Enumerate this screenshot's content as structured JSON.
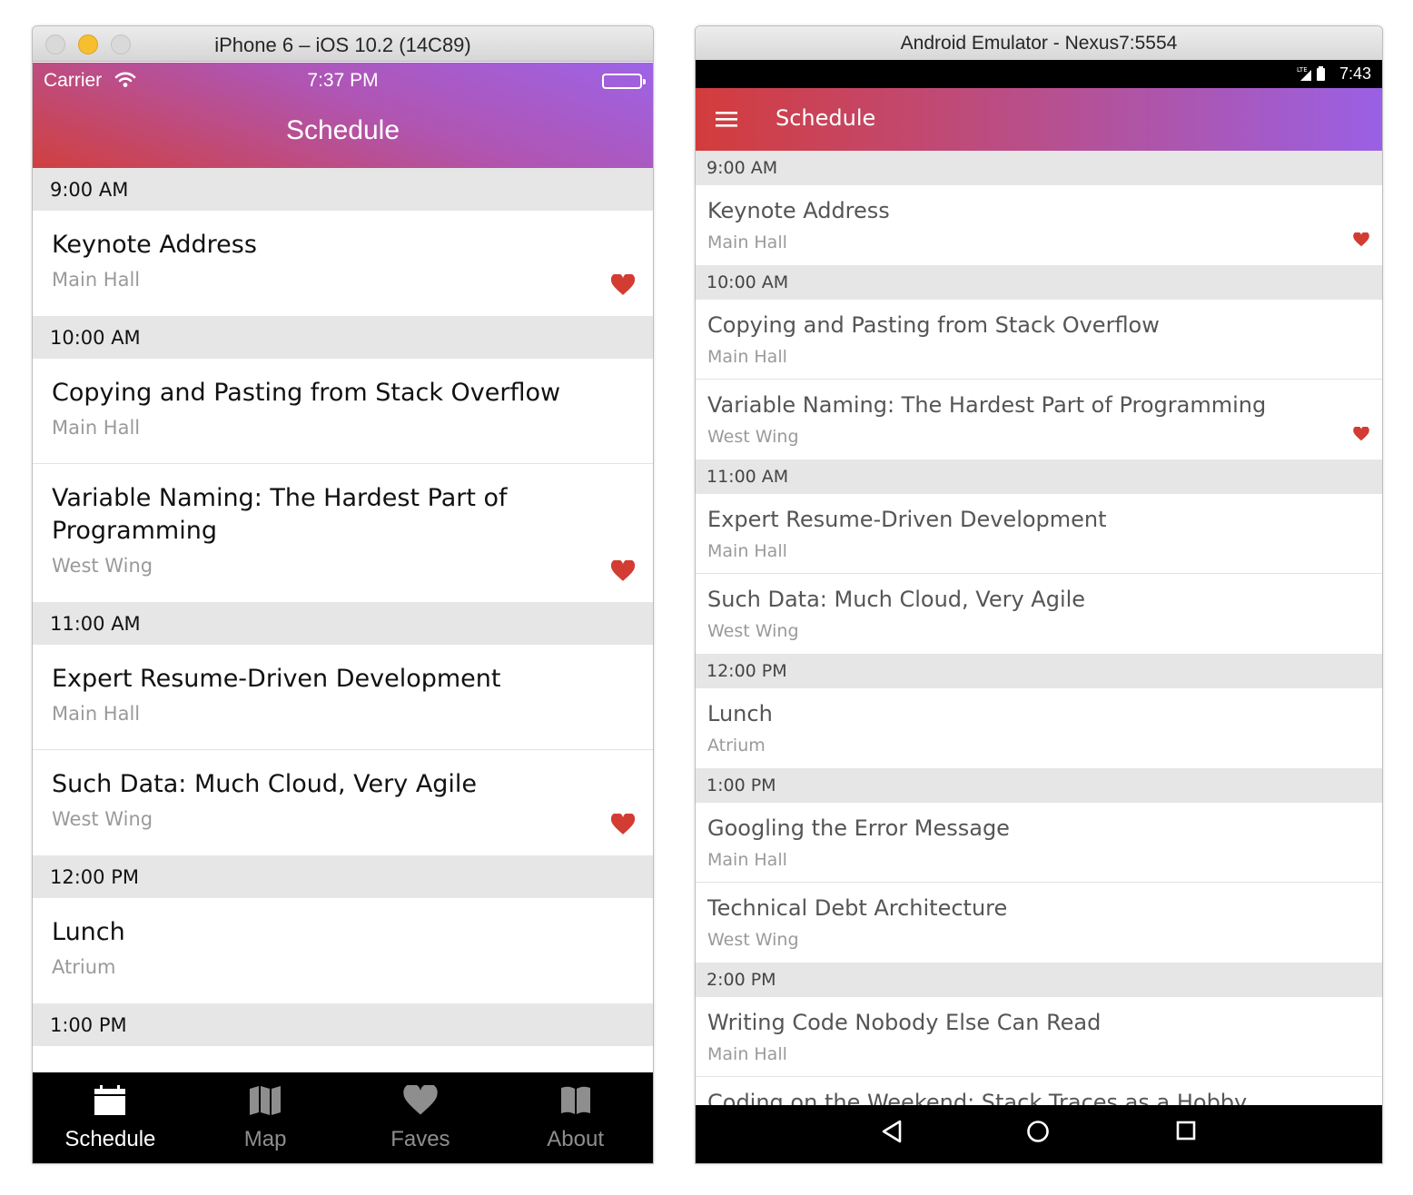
{
  "colors": {
    "accent_red": "#d0403e",
    "accent_purple": "#9d63e7",
    "heart": "#d23c33",
    "section_bg": "#e6e6e6"
  },
  "ios": {
    "window_title": "iPhone 6 – iOS 10.2 (14C89)",
    "status": {
      "carrier": "Carrier",
      "time": "7:37 PM",
      "wifi_icon": "wifi-icon",
      "battery_icon": "battery-icon"
    },
    "nav_title": "Schedule",
    "sections": [
      {
        "time": "9:00 AM",
        "sessions": [
          {
            "title": "Keynote Address",
            "room": "Main Hall",
            "favorite": true
          }
        ]
      },
      {
        "time": "10:00 AM",
        "sessions": [
          {
            "title": "Copying and Pasting from Stack Overflow",
            "room": "Main Hall",
            "favorite": false
          },
          {
            "title": "Variable Naming: The Hardest Part of Programming",
            "room": "West Wing",
            "favorite": true
          }
        ]
      },
      {
        "time": "11:00 AM",
        "sessions": [
          {
            "title": "Expert Resume-Driven Development",
            "room": "Main Hall",
            "favorite": false
          },
          {
            "title": "Such Data: Much Cloud, Very Agile",
            "room": "West Wing",
            "favorite": true
          }
        ]
      },
      {
        "time": "12:00 PM",
        "sessions": [
          {
            "title": "Lunch",
            "room": "Atrium",
            "favorite": false
          }
        ]
      },
      {
        "time": "1:00 PM",
        "sessions": []
      }
    ],
    "tabs": [
      {
        "label": "Schedule",
        "icon": "calendar-icon",
        "active": true
      },
      {
        "label": "Map",
        "icon": "map-icon",
        "active": false
      },
      {
        "label": "Faves",
        "icon": "heart-icon",
        "active": false
      },
      {
        "label": "About",
        "icon": "book-icon",
        "active": false
      }
    ]
  },
  "android": {
    "window_title": "Android Emulator - Nexus7:5554",
    "status": {
      "time": "7:43",
      "signal_icon": "lte-signal-icon",
      "battery_icon": "battery-icon"
    },
    "toolbar_title": "Schedule",
    "menu_icon": "hamburger-menu-icon",
    "sections": [
      {
        "time": "9:00 AM",
        "sessions": [
          {
            "title": "Keynote Address",
            "room": "Main Hall",
            "favorite": true
          }
        ]
      },
      {
        "time": "10:00 AM",
        "sessions": [
          {
            "title": "Copying and Pasting from Stack Overflow",
            "room": "Main Hall",
            "favorite": false
          },
          {
            "title": "Variable Naming: The Hardest Part of Programming",
            "room": "West Wing",
            "favorite": true
          }
        ]
      },
      {
        "time": "11:00 AM",
        "sessions": [
          {
            "title": "Expert Resume-Driven Development",
            "room": "Main Hall",
            "favorite": false
          },
          {
            "title": "Such Data: Much Cloud, Very Agile",
            "room": "West Wing",
            "favorite": false
          }
        ]
      },
      {
        "time": "12:00 PM",
        "sessions": [
          {
            "title": "Lunch",
            "room": "Atrium",
            "favorite": false
          }
        ]
      },
      {
        "time": "1:00 PM",
        "sessions": [
          {
            "title": "Googling the Error Message",
            "room": "Main Hall",
            "favorite": false
          },
          {
            "title": "Technical Debt Architecture",
            "room": "West Wing",
            "favorite": false
          }
        ]
      },
      {
        "time": "2:00 PM",
        "sessions": [
          {
            "title": "Writing Code Nobody Else Can Read",
            "room": "Main Hall",
            "favorite": false
          },
          {
            "title": "Coding on the Weekend: Stack Traces as a Hobby",
            "room": "",
            "favorite": false
          }
        ]
      }
    ],
    "nav_buttons": [
      "back-icon",
      "home-icon",
      "recents-icon"
    ]
  }
}
